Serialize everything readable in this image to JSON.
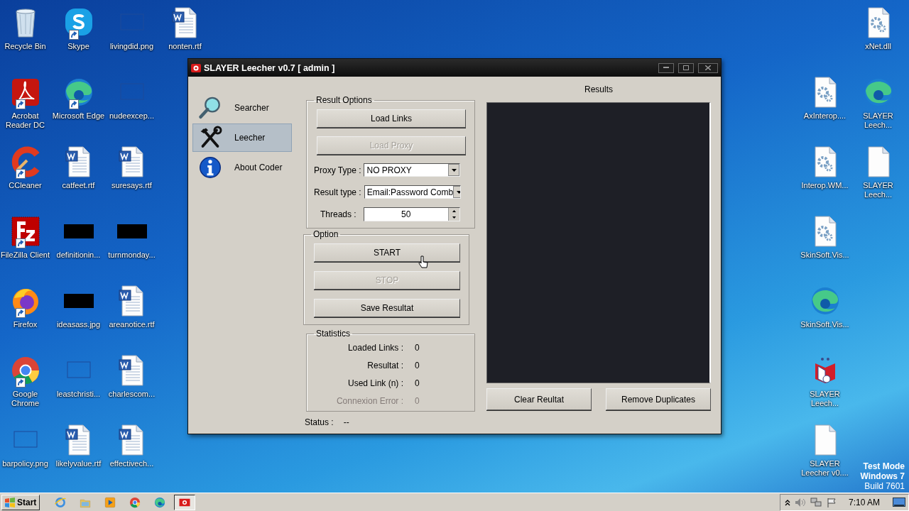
{
  "desktop": {
    "left_icons": [
      {
        "label": "Recycle Bin",
        "kind": "recycle",
        "shortcut": false
      },
      {
        "label": "Acrobat Reader DC",
        "kind": "acrobat",
        "shortcut": true
      },
      {
        "label": "CCleaner",
        "kind": "ccleaner",
        "shortcut": true
      },
      {
        "label": "FileZilla Client",
        "kind": "filezilla",
        "shortcut": true
      },
      {
        "label": "Firefox",
        "kind": "firefox",
        "shortcut": true
      },
      {
        "label": "Google Chrome",
        "kind": "chrome",
        "shortcut": true
      },
      {
        "label": "barpolicy.png",
        "kind": "image",
        "shortcut": false
      },
      {
        "label": "Skype",
        "kind": "skype",
        "shortcut": true
      },
      {
        "label": "Microsoft Edge",
        "kind": "edge",
        "shortcut": true
      },
      {
        "label": "catfeet.rtf",
        "kind": "word",
        "shortcut": false
      },
      {
        "label": "definitionin...",
        "kind": "dark",
        "shortcut": false
      },
      {
        "label": "ideasass.jpg",
        "kind": "dark",
        "shortcut": false
      },
      {
        "label": "leastchristi...",
        "kind": "image",
        "shortcut": false
      },
      {
        "label": "likelyvalue.rtf",
        "kind": "word",
        "shortcut": false
      },
      {
        "label": "livingdid.png",
        "kind": "image",
        "shortcut": false
      },
      {
        "label": "nudeexcep...",
        "kind": "image",
        "shortcut": false
      },
      {
        "label": "suresays.rtf",
        "kind": "word",
        "shortcut": false
      },
      {
        "label": "turnmonday...",
        "kind": "dark",
        "shortcut": false
      },
      {
        "label": "areanotice.rtf",
        "kind": "word",
        "shortcut": false
      },
      {
        "label": "charlescom...",
        "kind": "word",
        "shortcut": false
      },
      {
        "label": "effectivech...",
        "kind": "word",
        "shortcut": false
      },
      {
        "label": "nonten.rtf",
        "kind": "word",
        "shortcut": false
      }
    ],
    "right_columns": [
      [
        {
          "label": "xNet.dll",
          "kind": "gear",
          "shortcut": false
        },
        {
          "label": "SLAYER Leech...",
          "kind": "edge",
          "shortcut": false
        },
        {
          "label": "SLAYER Leech...",
          "kind": "blank",
          "shortcut": false
        }
      ],
      [
        {
          "label": "AxInterop....",
          "kind": "gear",
          "shortcut": false
        },
        {
          "label": "Interop.WM...",
          "kind": "gear",
          "shortcut": false
        },
        {
          "label": "SkinSoft.Vis...",
          "kind": "gear",
          "shortcut": false
        },
        {
          "label": "SkinSoft.Vis...",
          "kind": "edge",
          "shortcut": false
        },
        {
          "label": "SLAYER Leech...",
          "kind": "slayer",
          "shortcut": false
        },
        {
          "label": "SLAYER Leecher v0....",
          "kind": "blank",
          "shortcut": false
        }
      ]
    ],
    "os_notice": [
      "Test Mode",
      "Windows 7",
      "Build 7601"
    ]
  },
  "window": {
    "title": "SLAYER Leecher v0.7 [ admin ]",
    "nav": [
      {
        "label": "Searcher",
        "kind": "search",
        "selected": false
      },
      {
        "label": "Leecher",
        "kind": "tools",
        "selected": true
      },
      {
        "label": "About Coder",
        "kind": "info",
        "selected": false
      }
    ],
    "result_options": {
      "title": "Result Options",
      "buttons": [
        {
          "label": "Load Links",
          "disabled": false
        },
        {
          "label": "Load Proxy",
          "disabled": true
        }
      ],
      "proxy_type": {
        "label": "Proxy Type :",
        "value": "NO PROXY"
      },
      "result_type": {
        "label": "Result type :",
        "value": "Email:Password Comb"
      },
      "threads": {
        "label": "Threads :",
        "value": "50"
      }
    },
    "option": {
      "title": "Option",
      "buttons": [
        {
          "label": "START",
          "disabled": false
        },
        {
          "label": "STOP",
          "disabled": true
        },
        {
          "label": "Save Resultat",
          "disabled": false
        }
      ]
    },
    "statistics": {
      "title": "Statistics",
      "rows": [
        {
          "label": "Loaded Links :",
          "value": "0",
          "disabled": false
        },
        {
          "label": "Resultat :",
          "value": "0",
          "disabled": false
        },
        {
          "label": "Used Link (n) :",
          "value": "0",
          "disabled": false
        },
        {
          "label": "Connexion Error :",
          "value": "0",
          "disabled": true
        }
      ]
    },
    "status": {
      "label": "Status :",
      "value": "--"
    },
    "results": {
      "title": "Results",
      "buttons": [
        {
          "label": "Clear Reultat",
          "disabled": false
        },
        {
          "label": "Remove Duplicates",
          "disabled": false
        }
      ]
    }
  },
  "taskbar": {
    "start": "Start",
    "apps": [
      {
        "kind": "ie",
        "selected": false
      },
      {
        "kind": "explorer",
        "selected": false
      },
      {
        "kind": "media",
        "selected": false
      },
      {
        "kind": "chrome",
        "selected": false
      },
      {
        "kind": "edge",
        "selected": false
      },
      {
        "kind": "slayerapp",
        "selected": true
      }
    ],
    "clock": "7:10 AM"
  }
}
